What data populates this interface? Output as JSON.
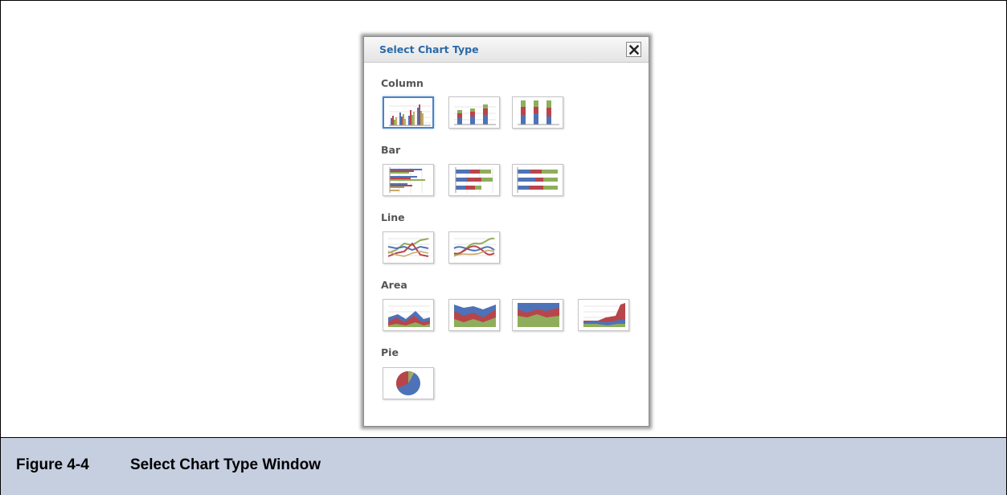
{
  "dialog": {
    "title": "Select Chart Type",
    "close_icon": "close-icon"
  },
  "sections": [
    {
      "label": "Column",
      "options": [
        {
          "name": "clustered-column",
          "icon": "column-clustered-icon",
          "selected": true
        },
        {
          "name": "stacked-column",
          "icon": "column-stacked-icon",
          "selected": false
        },
        {
          "name": "percent-stacked-column",
          "icon": "column-percent-stacked-icon",
          "selected": false
        }
      ]
    },
    {
      "label": "Bar",
      "options": [
        {
          "name": "clustered-bar",
          "icon": "bar-clustered-icon",
          "selected": false
        },
        {
          "name": "stacked-bar",
          "icon": "bar-stacked-icon",
          "selected": false
        },
        {
          "name": "percent-stacked-bar",
          "icon": "bar-percent-stacked-icon",
          "selected": false
        }
      ]
    },
    {
      "label": "Line",
      "options": [
        {
          "name": "line",
          "icon": "line-icon",
          "selected": false
        },
        {
          "name": "smooth-line",
          "icon": "line-smooth-icon",
          "selected": false
        }
      ]
    },
    {
      "label": "Area",
      "options": [
        {
          "name": "area",
          "icon": "area-icon",
          "selected": false
        },
        {
          "name": "stacked-area",
          "icon": "area-stacked-icon",
          "selected": false
        },
        {
          "name": "percent-stacked-area",
          "icon": "area-percent-stacked-icon",
          "selected": false
        },
        {
          "name": "step-area",
          "icon": "area-step-icon",
          "selected": false
        }
      ]
    },
    {
      "label": "Pie",
      "options": [
        {
          "name": "pie",
          "icon": "pie-icon",
          "selected": false
        }
      ]
    }
  ],
  "caption": {
    "number": "Figure 4-4",
    "text": "Select Chart Type Window"
  },
  "colors": {
    "caption_bg": "#c5cfe0",
    "title": "#2a6aa8",
    "series_blue": "#4e72b8",
    "series_red": "#b8454a",
    "series_green": "#8fae5c",
    "series_tan": "#c8a86a"
  }
}
